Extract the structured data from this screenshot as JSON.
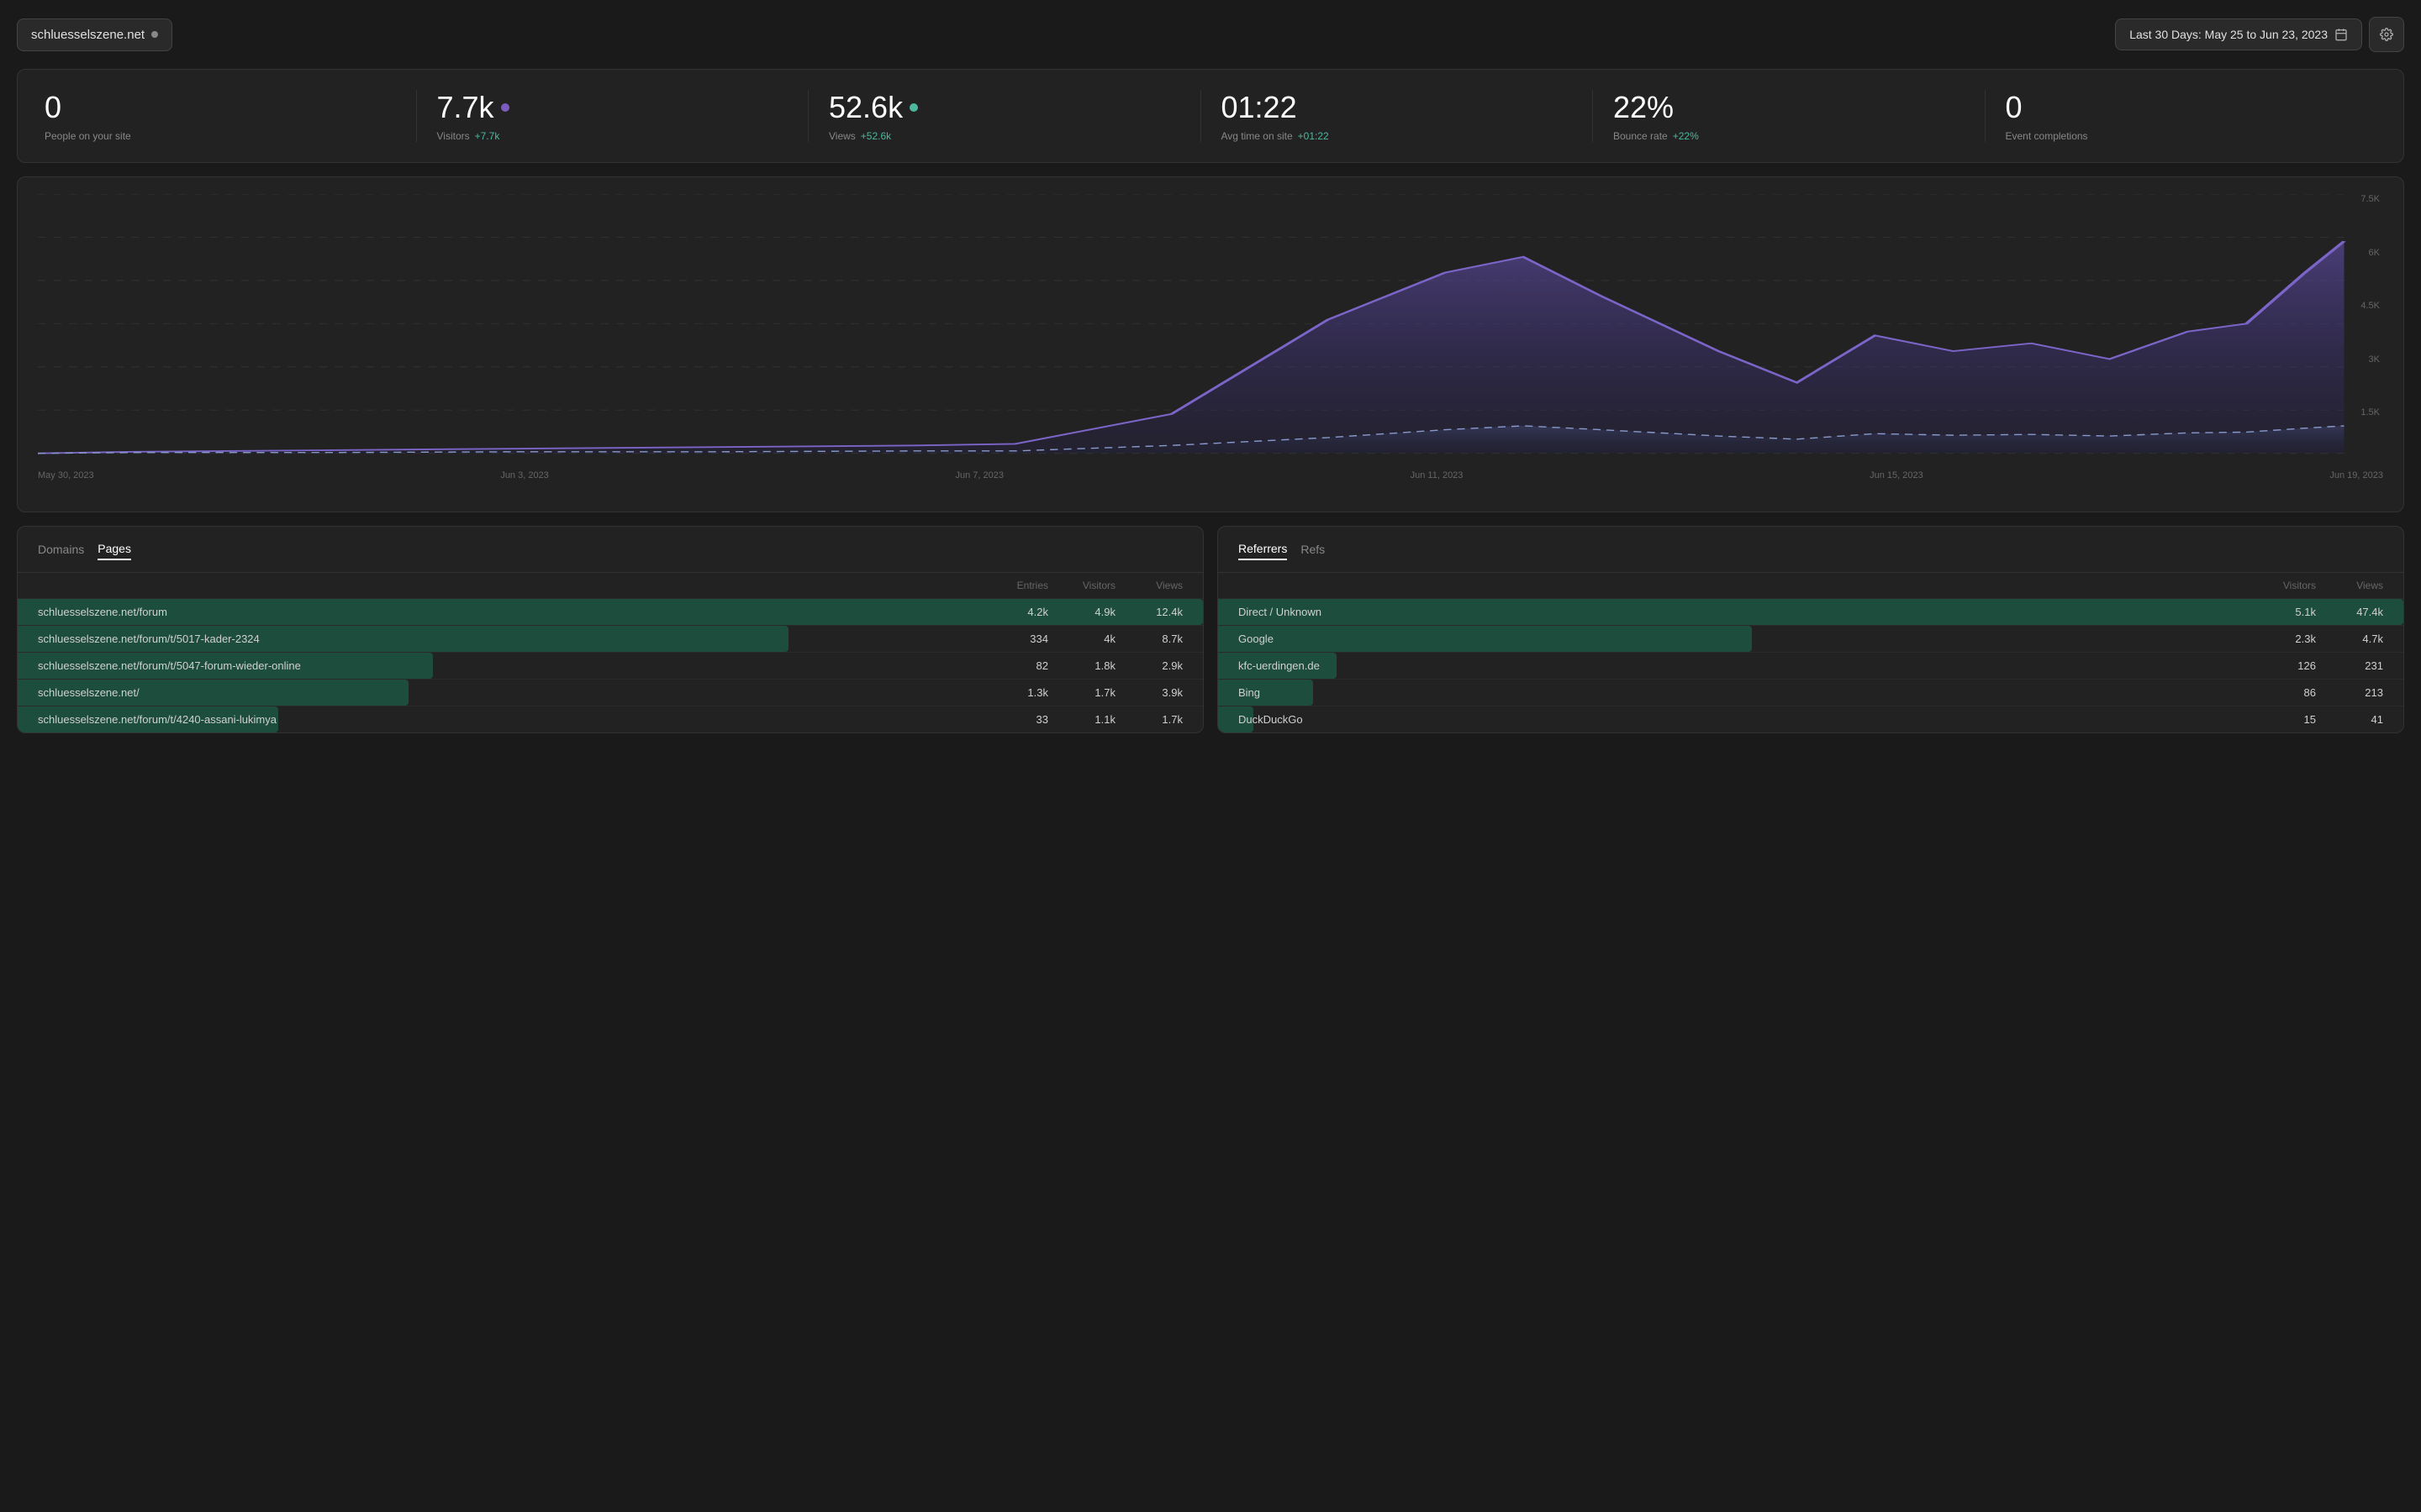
{
  "header": {
    "site_name": "schluesselszene.net",
    "site_dot_color": "#888",
    "date_range_label": "Last 30 Days: May 25 to Jun 23, 2023",
    "calendar_icon": "📅",
    "settings_icon": "⚙"
  },
  "stats": [
    {
      "key": "people",
      "value": "0",
      "label": "People on your site",
      "change": null,
      "dot": null
    },
    {
      "key": "visitors",
      "value": "7.7k",
      "label": "Visitors",
      "change": "+7.7k",
      "dot": "purple"
    },
    {
      "key": "views",
      "value": "52.6k",
      "label": "Views",
      "change": "+52.6k",
      "dot": "teal"
    },
    {
      "key": "avg_time",
      "value": "01:22",
      "label": "Avg time on site",
      "change": "+01:22",
      "dot": null
    },
    {
      "key": "bounce_rate",
      "value": "22%",
      "label": "Bounce rate",
      "change": "+22%",
      "dot": null
    },
    {
      "key": "events",
      "value": "0",
      "label": "Event completions",
      "change": null,
      "dot": null
    }
  ],
  "chart": {
    "x_labels": [
      "May 30, 2023",
      "Jun 3, 2023",
      "Jun 7, 2023",
      "Jun 11, 2023",
      "Jun 15, 2023",
      "Jun 19, 2023"
    ],
    "y_labels": [
      "7.5K",
      "6K",
      "4.5K",
      "3K",
      "1.5K",
      ""
    ]
  },
  "pages_table": {
    "tabs": [
      {
        "key": "domains",
        "label": "Domains",
        "active": false
      },
      {
        "key": "pages",
        "label": "Pages",
        "active": true
      }
    ],
    "columns": [
      "Entries",
      "Visitors",
      "Views"
    ],
    "rows": [
      {
        "page": "schluesselszene.net/forum",
        "entries": "4.2k",
        "visitors": "4.9k",
        "views": "12.4k",
        "bar_pct": 100
      },
      {
        "page": "schluesselszene.net/forum/t/5017-kader-2324",
        "entries": "334",
        "visitors": "4k",
        "views": "8.7k",
        "bar_pct": 65
      },
      {
        "page": "schluesselszene.net/forum/t/5047-forum-wieder-online",
        "entries": "82",
        "visitors": "1.8k",
        "views": "2.9k",
        "bar_pct": 35
      },
      {
        "page": "schluesselszene.net/",
        "entries": "1.3k",
        "visitors": "1.7k",
        "views": "3.9k",
        "bar_pct": 33
      },
      {
        "page": "schluesselszene.net/forum/t/4240-assani-lukimya",
        "entries": "33",
        "visitors": "1.1k",
        "views": "1.7k",
        "bar_pct": 22
      }
    ]
  },
  "referrers_table": {
    "tabs": [
      {
        "key": "referrers",
        "label": "Referrers",
        "active": true
      },
      {
        "key": "refs",
        "label": "Refs",
        "active": false
      }
    ],
    "columns": [
      "Visitors",
      "Views"
    ],
    "rows": [
      {
        "referrer": "Direct / Unknown",
        "visitors": "5.1k",
        "views": "47.4k",
        "bar_pct": 100
      },
      {
        "referrer": "Google",
        "visitors": "2.3k",
        "views": "4.7k",
        "bar_pct": 45
      },
      {
        "referrer": "kfc-uerdingen.de",
        "visitors": "126",
        "views": "231",
        "bar_pct": 10
      },
      {
        "referrer": "Bing",
        "visitors": "86",
        "views": "213",
        "bar_pct": 8
      },
      {
        "referrer": "DuckDuckGo",
        "visitors": "15",
        "views": "41",
        "bar_pct": 3
      }
    ]
  }
}
